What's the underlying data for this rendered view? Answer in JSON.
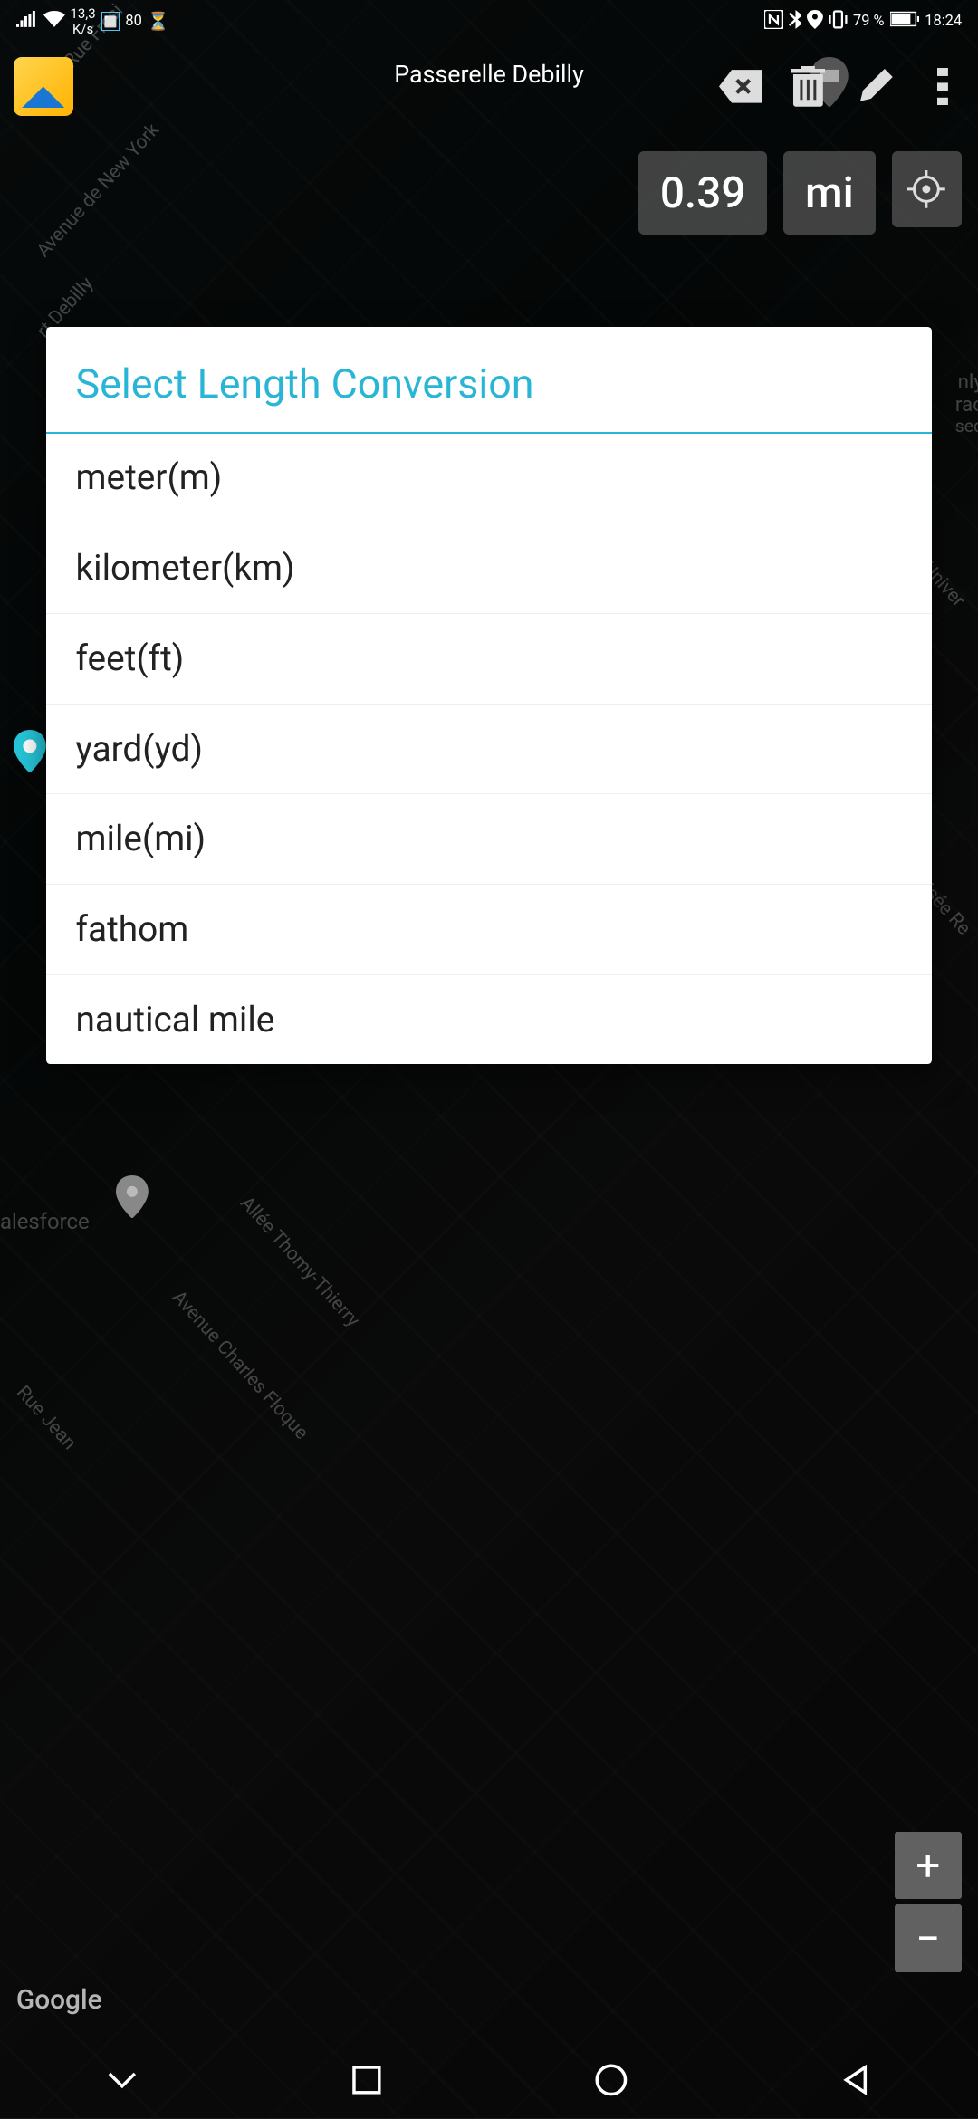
{
  "status_bar": {
    "wifi_speed": "13,3",
    "wifi_speed_unit": "K/s",
    "temp_badge": "80",
    "battery_pct": "79 %",
    "time": "18:24"
  },
  "toolbar": {
    "location_title": "Passerelle Debilly"
  },
  "distance": {
    "value": "0.39",
    "unit": "mi"
  },
  "dialog": {
    "title": "Select Length Conversion",
    "items": [
      "meter(m)",
      "kilometer(km)",
      "feet(ft)",
      "yard(yd)",
      "mile(mi)",
      "fathom",
      "nautical mile"
    ]
  },
  "map_labels": {
    "ave_newyork": "Avenue de New York",
    "rue_fresi": "Rue Fresi",
    "debilly": "rt Debilly",
    "allee": "Allée Thomy-Thierry",
    "charles": "Avenue Charles Floque",
    "rue_jean": "Rue Jean",
    "salesforce": "alesforce",
    "univer": "Univer",
    "elisee": "Élisée Re",
    "google": "Google",
    "nly": "nly",
    "rac": "rac",
    "sed": "sed"
  },
  "icons": {
    "signal": "signal-icon",
    "wifi": "wifi-icon",
    "hourglass": "hourglass-icon",
    "nfc": "nfc-icon",
    "bluetooth": "bluetooth-icon",
    "location": "location-icon",
    "vibrate": "vibrate-icon",
    "battery": "battery-icon",
    "backspace": "backspace-icon",
    "trash": "trash-icon",
    "pencil": "pencil-icon",
    "menu": "menu-icon",
    "crosshair": "crosshair-icon",
    "zoom_in": "+",
    "zoom_out": "−",
    "nav_down": "chevron-down-icon",
    "nav_recent": "square-icon",
    "nav_home": "circle-icon",
    "nav_back": "triangle-back-icon"
  }
}
